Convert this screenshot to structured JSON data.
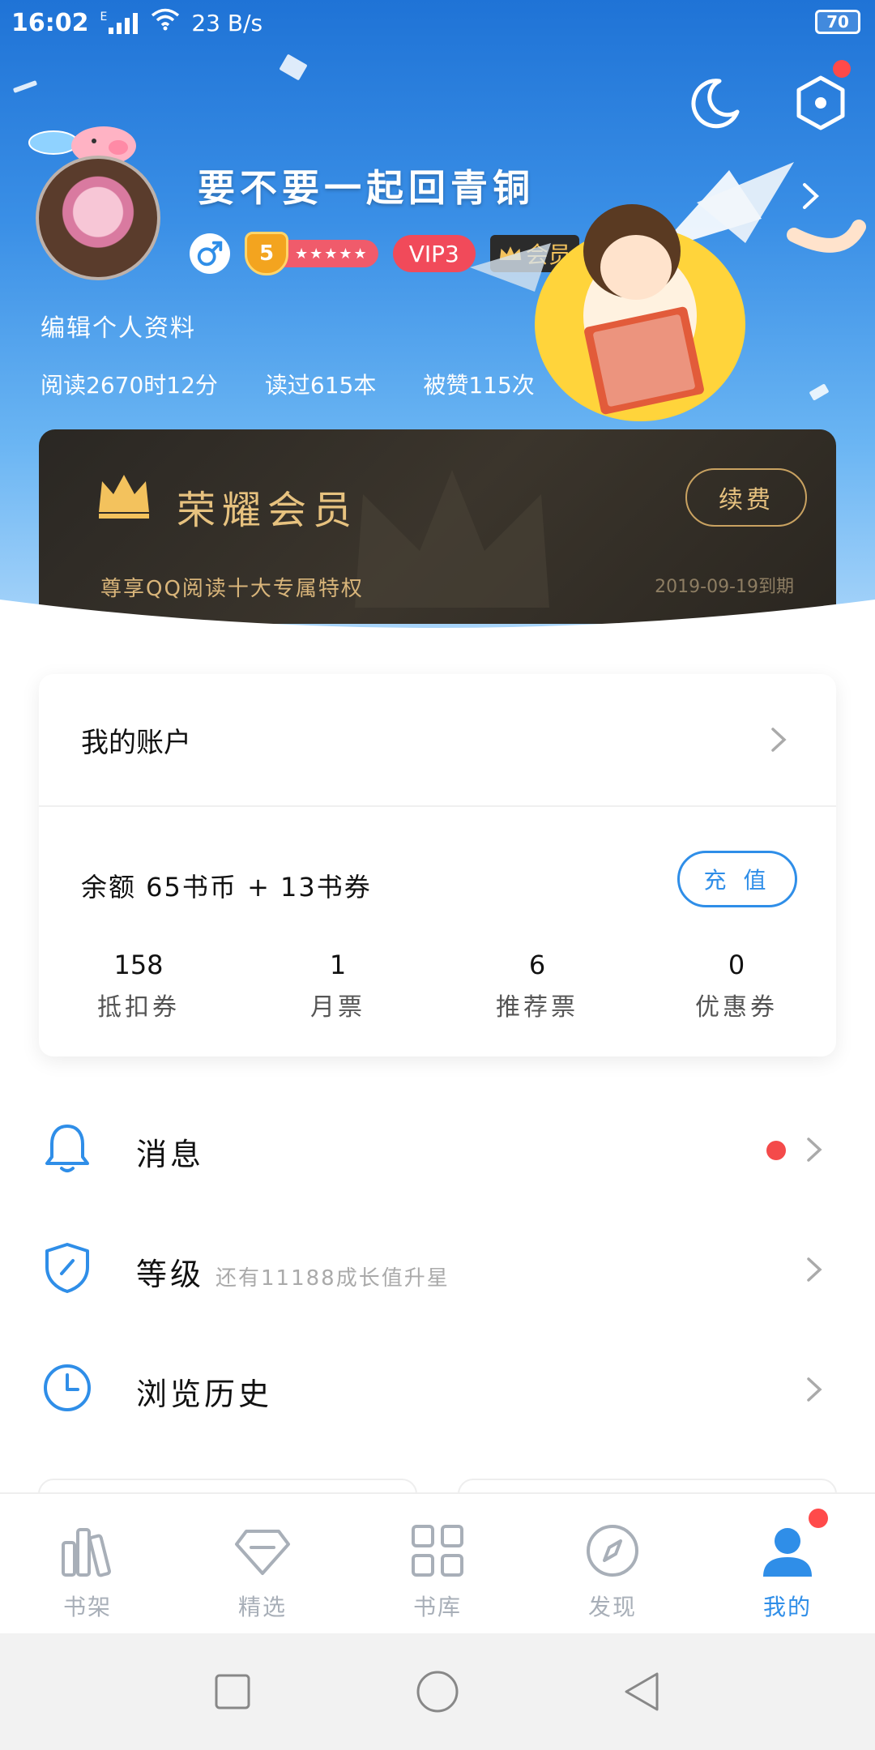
{
  "status_bar": {
    "time": "16:02",
    "network": "E",
    "speed": "23 B/s",
    "battery": "70"
  },
  "profile": {
    "username": "要不要一起回青铜",
    "level": "5",
    "level_stars": "★★★★★",
    "vip": "VIP3",
    "member": "会员",
    "edit_link": "编辑个人资料",
    "stats": {
      "reading_time": "阅读2670时12分",
      "books_read": "读过615本",
      "likes": "被赞115次"
    }
  },
  "membership": {
    "title": "荣耀会员",
    "renew_label": "续费",
    "subtitle": "尊享QQ阅读十大专属特权",
    "expiry": "2019-09-19到期"
  },
  "account": {
    "title": "我的账户",
    "balance": "余额  65书币 + 13书券",
    "recharge_label": "充 值",
    "tickets": [
      {
        "num": "158",
        "label": "抵扣券"
      },
      {
        "num": "1",
        "label": "月票"
      },
      {
        "num": "6",
        "label": "推荐票"
      },
      {
        "num": "0",
        "label": "优惠券"
      }
    ]
  },
  "menu": {
    "messages": "消息",
    "level": "等级",
    "level_hint": "还有11188成长值升星",
    "history": "浏览历史"
  },
  "tabs": [
    {
      "label": "书架",
      "icon": "bookshelf-icon"
    },
    {
      "label": "精选",
      "icon": "diamond-icon"
    },
    {
      "label": "书库",
      "icon": "grid-icon"
    },
    {
      "label": "发现",
      "icon": "compass-icon"
    },
    {
      "label": "我的",
      "icon": "user-icon"
    }
  ],
  "colors": {
    "accent": "#2f8ee8",
    "notice_red": "#f44a4a",
    "gold": "#e7c27f"
  }
}
